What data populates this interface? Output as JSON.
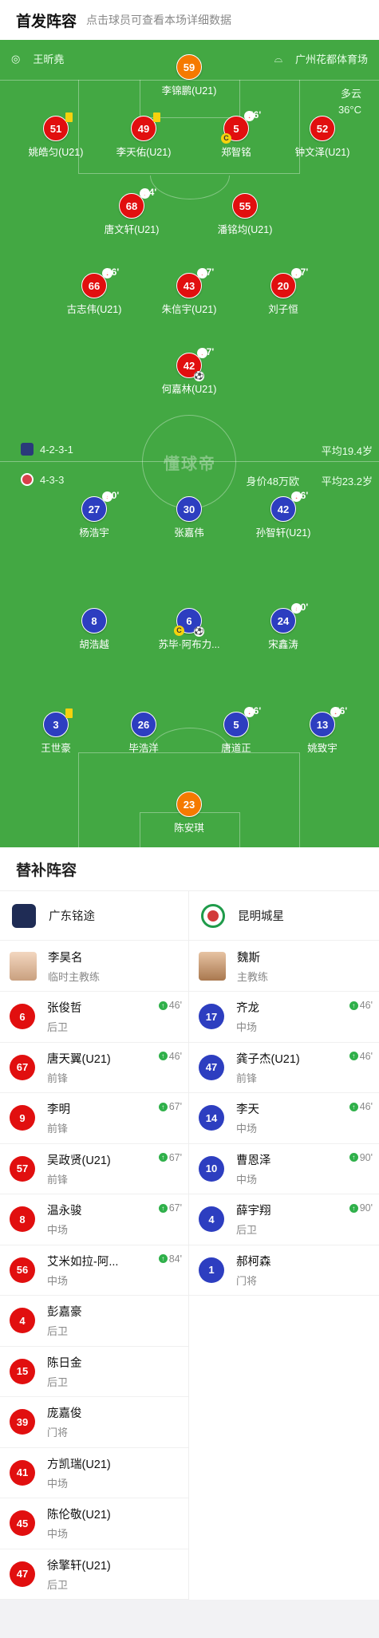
{
  "header": {
    "title": "首发阵容",
    "hint": "点击球员可查看本场详细数据"
  },
  "match_info": {
    "referee": "王昕堯",
    "venue": "广州花都体育场",
    "weather": "多云",
    "temperature": "36°C",
    "watermark": "懂球帝"
  },
  "home": {
    "formation": "4-2-3-1",
    "avg_age": "平均19.4岁",
    "players": [
      {
        "n": "59",
        "name": "李锦鹏(U21)",
        "color": "orange"
      },
      {
        "n": "51",
        "name": "姚皓匀(U21)",
        "yc": true
      },
      {
        "n": "49",
        "name": "李天佑(U21)",
        "yc": true
      },
      {
        "n": "5",
        "name": "郑智铭",
        "sub": "46'",
        "capt": "C"
      },
      {
        "n": "52",
        "name": "钟文泽(U21)"
      },
      {
        "n": "68",
        "name": "唐文轩(U21)",
        "sub": "84'"
      },
      {
        "n": "55",
        "name": "潘铭均(U21)"
      },
      {
        "n": "66",
        "name": "古志伟(U21)",
        "sub": "46'"
      },
      {
        "n": "43",
        "name": "朱信宇(U21)",
        "sub": "67'"
      },
      {
        "n": "20",
        "name": "刘子恒",
        "sub": "67'"
      },
      {
        "n": "42",
        "name": "何嘉林(U21)",
        "sub": "67'",
        "goal": true
      }
    ]
  },
  "away": {
    "formation": "4-3-3",
    "value": "身价48万欧",
    "avg_age": "平均23.2岁",
    "players": [
      {
        "n": "27",
        "name": "杨浩宇",
        "sub": "90'"
      },
      {
        "n": "30",
        "name": "张嘉伟"
      },
      {
        "n": "42",
        "name": "孙智轩(U21)",
        "sub": "46'"
      },
      {
        "n": "8",
        "name": "胡浩越"
      },
      {
        "n": "6",
        "name": "苏毕·阿布力...",
        "capt": "C",
        "goal": true
      },
      {
        "n": "24",
        "name": "宋鑫涛",
        "sub": "90'"
      },
      {
        "n": "3",
        "name": "王世豪",
        "yc": true
      },
      {
        "n": "26",
        "name": "毕浩洋"
      },
      {
        "n": "5",
        "name": "唐道正",
        "sub": "46'"
      },
      {
        "n": "13",
        "name": "姚致宇",
        "sub": "46'"
      },
      {
        "n": "23",
        "name": "陈安琪",
        "color": "orange"
      }
    ]
  },
  "subs": {
    "title": "替补阵容",
    "home": {
      "team": "广东铭途",
      "coach": {
        "name": "李昊名",
        "role": "临时主教练"
      },
      "players": [
        {
          "n": "6",
          "name": "张俊哲",
          "pos": "后卫",
          "in": "46'"
        },
        {
          "n": "67",
          "name": "唐天翼(U21)",
          "pos": "前锋",
          "in": "46'"
        },
        {
          "n": "9",
          "name": "李明",
          "pos": "前锋",
          "in": "67'"
        },
        {
          "n": "57",
          "name": "吴政贤(U21)",
          "pos": "前锋",
          "in": "67'"
        },
        {
          "n": "8",
          "name": "温永骏",
          "pos": "中场",
          "in": "67'"
        },
        {
          "n": "56",
          "name": "艾米如拉-阿...",
          "pos": "中场",
          "in": "84'"
        },
        {
          "n": "4",
          "name": "彭嘉豪",
          "pos": "后卫"
        },
        {
          "n": "15",
          "name": "陈日金",
          "pos": "后卫"
        },
        {
          "n": "39",
          "name": "庞嘉俊",
          "pos": "门将"
        },
        {
          "n": "41",
          "name": "方凯瑞(U21)",
          "pos": "中场"
        },
        {
          "n": "45",
          "name": "陈伦敬(U21)",
          "pos": "中场"
        },
        {
          "n": "47",
          "name": "徐擎轩(U21)",
          "pos": "后卫"
        }
      ]
    },
    "away": {
      "team": "昆明城星",
      "coach": {
        "name": "魏斯",
        "role": "主教练"
      },
      "players": [
        {
          "n": "17",
          "name": "齐龙",
          "pos": "中场",
          "in": "46'"
        },
        {
          "n": "47",
          "name": "龚子杰(U21)",
          "pos": "前锋",
          "in": "46'"
        },
        {
          "n": "14",
          "name": "李天",
          "pos": "中场",
          "in": "46'"
        },
        {
          "n": "10",
          "name": "曹恩泽",
          "pos": "中场",
          "in": "90'"
        },
        {
          "n": "4",
          "name": "薛宇翔",
          "pos": "后卫",
          "in": "90'"
        },
        {
          "n": "1",
          "name": "郝柯森",
          "pos": "门将"
        }
      ]
    }
  },
  "colors": {
    "pitch": "#43a843",
    "home": "#e10f0f",
    "away": "#2d3ec0",
    "gk": "#f57a00"
  }
}
